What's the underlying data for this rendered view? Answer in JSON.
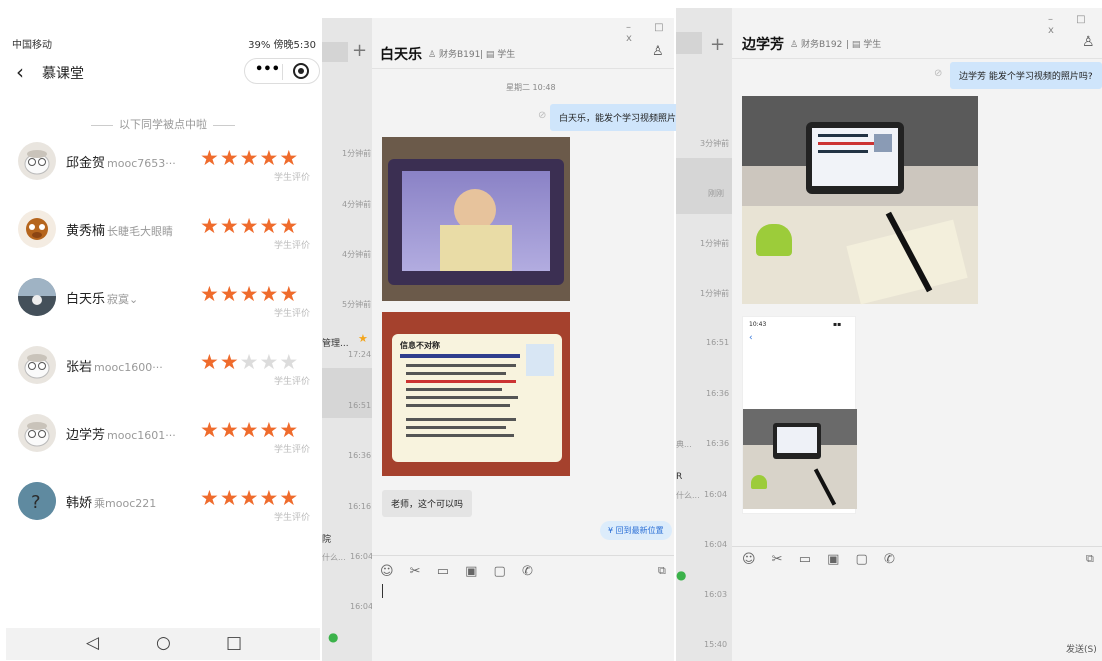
{
  "phone": {
    "status_left": "中国移动",
    "status_right": "39%  傍晚5:30",
    "title": "慕课堂",
    "more_label": "•••",
    "subhead": "以下同学被点中啦",
    "eval_label": "学生评价",
    "students": [
      {
        "name": "邱金贺",
        "nick": "mooc7653···",
        "rating": 5
      },
      {
        "name": "黄秀楠",
        "nick": "长睫毛大眼睛",
        "rating": 5
      },
      {
        "name": "白天乐",
        "nick": "寂寞⌄",
        "rating": 5
      },
      {
        "name": "张岩",
        "nick": "mooc1600···",
        "rating": 2
      },
      {
        "name": "边学芳",
        "nick": "mooc1601···",
        "rating": 5
      },
      {
        "name": "韩娇",
        "nick": "乘mooc221",
        "rating": 5
      }
    ]
  },
  "chat1": {
    "contact": "白天乐",
    "class_tag": "财务B191",
    "role_tag": "学生",
    "timestamp": "星期二 10:48",
    "outgoing": "白天乐，能发个学习视频照片吗?",
    "incoming": "老师，这个可以吗",
    "jump_label": "回到最新位置",
    "slide_title": "信息不对称",
    "sidebar_times": [
      "1分钟前",
      "4分钟前",
      "4分钟前",
      "5分钟前",
      "17:24",
      "16:51",
      "16:36",
      "16:16",
      "16:04",
      "16:04"
    ],
    "sidebar_snippets": [
      "管理...",
      "院",
      "什么..."
    ]
  },
  "chat2": {
    "contact": "边学芳",
    "class_tag": "财务B192",
    "role_tag": "学生",
    "outgoing": "边学芳 能发个学习视频的照片吗?",
    "send_label": "发送(S)",
    "sidebar_times": [
      "3分钟前",
      "刚刚",
      "1分钟前",
      "1分钟前",
      "16:51",
      "16:36",
      "16:36",
      "16:04",
      "16:04",
      "16:03",
      "15:40"
    ],
    "sidebar_snippets": [
      "典...",
      "R",
      "什么..."
    ]
  }
}
